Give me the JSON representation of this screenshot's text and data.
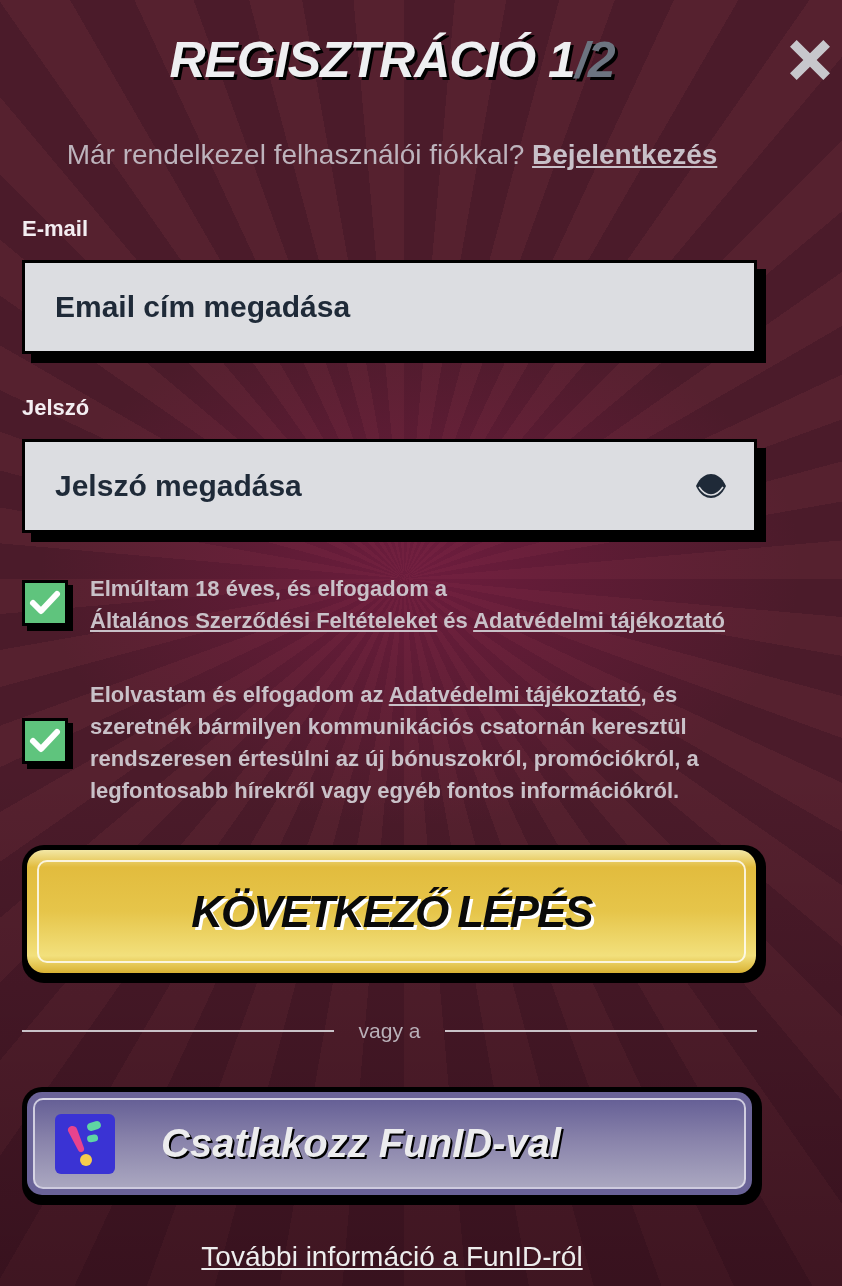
{
  "dialog": {
    "title": "REGISZTRÁCIÓ 1",
    "title_suffix": "/2"
  },
  "login_prompt": {
    "text": "Már rendelkezel felhasználói fiókkal?",
    "link": "Bejelentkezés"
  },
  "fields": [
    {
      "kind": "email",
      "label": "E-mail",
      "placeholder": "Email cím megadása"
    },
    {
      "kind": "password",
      "label": "Jelszó",
      "placeholder": "Jelszó megadása"
    }
  ],
  "consents": [
    {
      "checked": true,
      "parts": [
        {
          "kind": "text",
          "text": "Elmúltam 18 éves, és elfogadom a "
        },
        {
          "kind": "link",
          "text": "Általános Szerződési Feltételeket"
        },
        {
          "kind": "text",
          "text": " és "
        },
        {
          "kind": "link",
          "text": "Adatvédelmi tájékoztató"
        }
      ]
    },
    {
      "checked": true,
      "parts": [
        {
          "kind": "text",
          "text": "Elolvastam és elfogadom az "
        },
        {
          "kind": "link",
          "text": "Adatvédelmi tájékoztató"
        },
        {
          "kind": "text",
          "text": ", és szeretnék bármilyen kommunikációs csatornán keresztül rendszeresen értesülni az új bónuszokról, promóciókról, a legfontosabb hírekről vagy egyéb fontos információkról."
        }
      ]
    }
  ],
  "next_button": "KÖVETKEZŐ LÉPÉS",
  "divider": "vagy a",
  "funid_button": "Csatlakozz FunID-val",
  "funid_info_link": "További információ a FunID-ról"
}
